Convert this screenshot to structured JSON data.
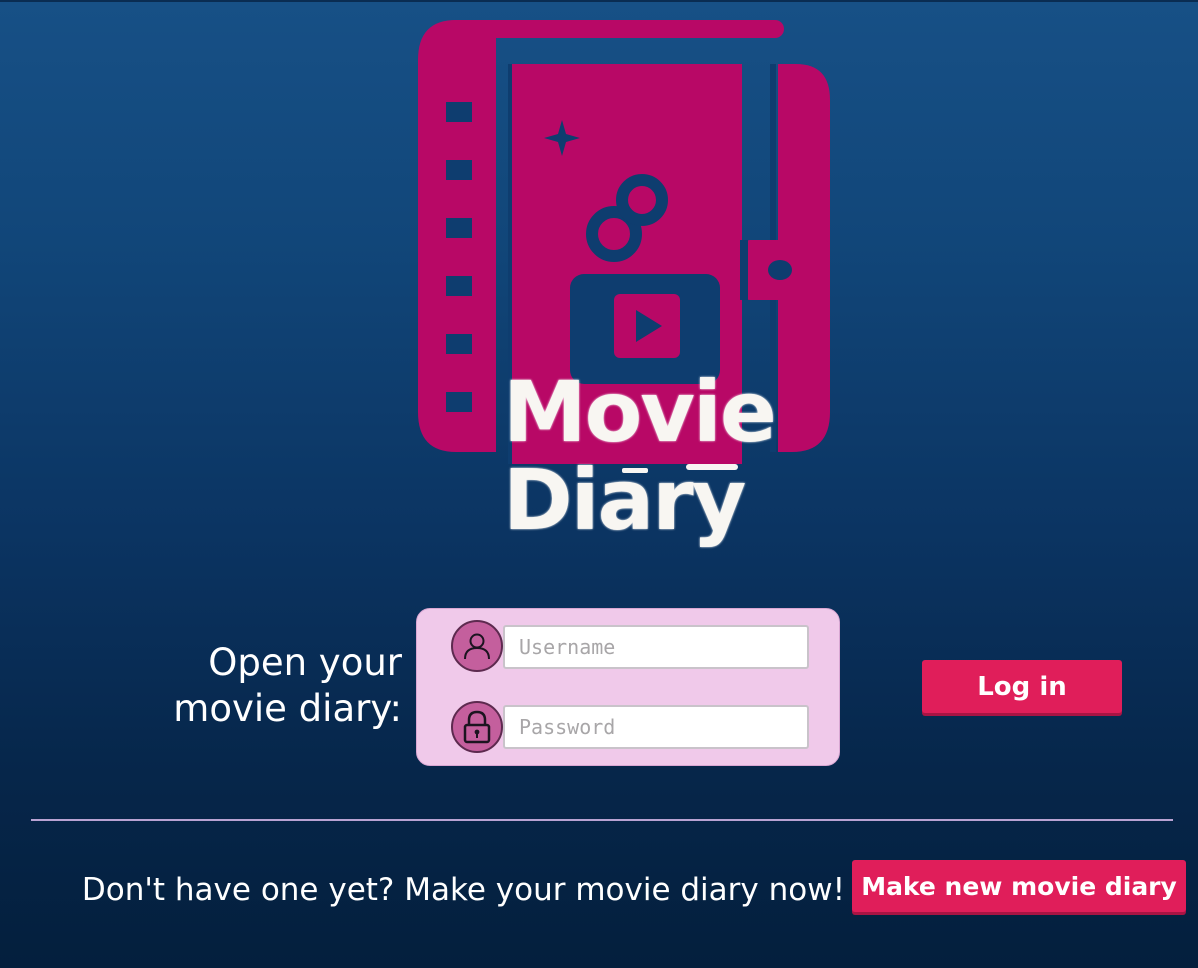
{
  "logo": {
    "word1": "Movie",
    "word2": "Diary",
    "icons": [
      "film-strip-icon",
      "sparkle-icon",
      "film-reel-icon",
      "play-button-icon"
    ]
  },
  "login": {
    "prompt": "Open your movie diary:",
    "username_placeholder": "Username",
    "password_placeholder": "Password",
    "login_label": "Log in"
  },
  "signup": {
    "prompt": "Don't have one yet? Make your movie diary now!",
    "button_label": "Make new movie diary"
  },
  "colors": {
    "logo_magenta": "#b80866",
    "button_pink": "#e01e5a",
    "login_box": "#f0c9ea",
    "icon_circle": "#c45f9d",
    "divider": "#b9a3d3"
  }
}
